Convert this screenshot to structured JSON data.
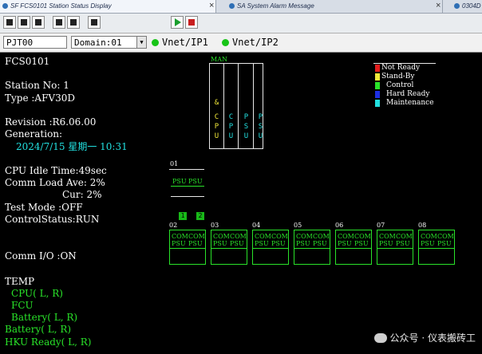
{
  "tabs": [
    {
      "label": "SF FCS0101  Station Status Display"
    },
    {
      "label": "SA  System Alarm Message"
    },
    {
      "label": "0304D"
    }
  ],
  "toolbar": {
    "buttons": [
      "print-icon",
      "window-icon",
      "copy-icon",
      "station-icon",
      "list-icon",
      "grid-icon",
      "run-icon",
      "stop-icon"
    ]
  },
  "station_bar": {
    "project": "PJT00",
    "domain": "Domain:01",
    "vnet1": "Vnet/IP1",
    "vnet2": "Vnet/IP2",
    "led_color": "#18c418"
  },
  "status": {
    "fcs": "FCS0101",
    "station_no": "Station No: 1",
    "type": "Type       :AFV30D",
    "revision": "Revision  :R6.06.00",
    "generation_label": "Generation:",
    "generation_value": "2024/7/15 星期一 10:31",
    "cpu_idle": "CPU Idle Time:49sec",
    "comm_load_ave": "Comm Load Ave: 2%",
    "comm_load_cur": "Cur: 2%",
    "test_mode": "Test Mode     :OFF",
    "control_status": "ControlStatus:RUN",
    "comm_io": "Comm I/O     :ON"
  },
  "temp": {
    "title": "TEMP",
    "items": [
      "CPU( L, R)",
      "FCU",
      "Battery( L, R)",
      "Battery( L, R)",
      "HKU Ready( L, R)"
    ]
  },
  "man": {
    "label": "MAN",
    "col1_top": "&",
    "col1": [
      "C",
      "P",
      "U"
    ],
    "col2": [
      "C",
      "P",
      "U"
    ],
    "col3": [
      "P",
      "S",
      "U"
    ],
    "col4": [
      "P",
      "S",
      "U"
    ]
  },
  "legend": [
    {
      "label": "Not Ready",
      "color": "#e21c1c"
    },
    {
      "label": "Stand-By",
      "color": "#f2e93a"
    },
    {
      "label": "Control",
      "color": "#29e329"
    },
    {
      "label": "Hard Ready",
      "color": "#1c2ee2"
    },
    {
      "label": "Maintenance",
      "color": "#22e0e0"
    }
  ],
  "node01": {
    "label": "01",
    "psu1": "PSU",
    "psu2": "PSU"
  },
  "indicators": [
    "1",
    "2"
  ],
  "nodes": [
    {
      "label": "02",
      "com1": "COM",
      "com2": "COM",
      "psu1": "PSU",
      "psu2": "PSU"
    },
    {
      "label": "03",
      "com1": "COM",
      "com2": "COM",
      "psu1": "PSU",
      "psu2": "PSU"
    },
    {
      "label": "04",
      "com1": "COM",
      "com2": "COM",
      "psu1": "PSU",
      "psu2": "PSU"
    },
    {
      "label": "05",
      "com1": "COM",
      "com2": "COM",
      "psu1": "PSU",
      "psu2": "PSU"
    },
    {
      "label": "06",
      "com1": "COM",
      "com2": "COM",
      "psu1": "PSU",
      "psu2": "PSU"
    },
    {
      "label": "07",
      "com1": "COM",
      "com2": "COM",
      "psu1": "PSU",
      "psu2": "PSU"
    },
    {
      "label": "08",
      "com1": "COM",
      "com2": "COM",
      "psu1": "PSU",
      "psu2": "PSU"
    }
  ],
  "watermark": "公众号 · 仪表搬砖工"
}
